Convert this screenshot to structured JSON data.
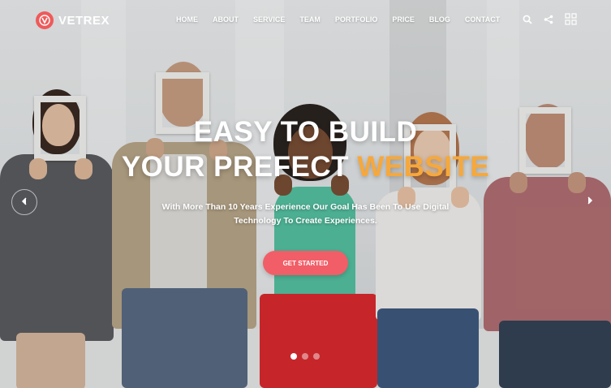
{
  "brand": {
    "name": "VETREX",
    "logo_letter": "V",
    "accent_color": "#ef5a5a"
  },
  "nav": {
    "items": [
      "HOME",
      "ABOUT",
      "SERVICE",
      "TEAM",
      "PORTFOLIO",
      "PRICE",
      "BLOG",
      "CONTACT"
    ]
  },
  "tools": {
    "icons": [
      "search-icon",
      "share-icon",
      "grid-menu-icon"
    ]
  },
  "hero": {
    "headline_line1": "EASY TO BUILD",
    "headline_line2_prefix": "YOUR PREFECT ",
    "headline_line2_accent": "WEBSITE",
    "accent_color": "#f6a83b",
    "subtitle_line1": "With More Than 10 Years Experience Our Goal Has Been To Use Digital",
    "subtitle_line2": "Technology To Create Experiences.",
    "cta_label": "GET STARTED",
    "cta_color": "#f15e67"
  },
  "slider": {
    "prev_icon": "chevron-left-icon",
    "next_icon": "chevron-right-icon",
    "dots": 3,
    "active_dot": 1
  }
}
